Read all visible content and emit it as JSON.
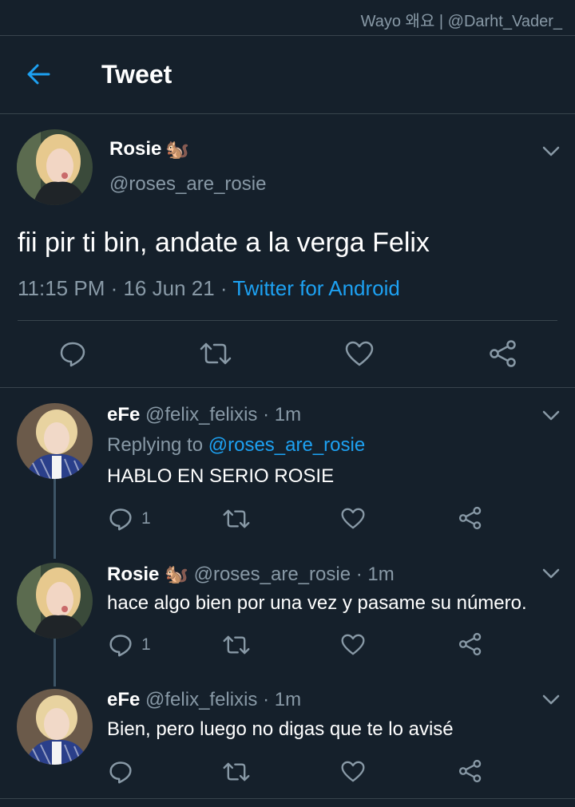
{
  "watermark": "Wayo 왜요 | @Darht_Vader_",
  "header": {
    "title": "Tweet",
    "back_icon": "arrow-left-icon"
  },
  "colors": {
    "background": "#15202b",
    "accent": "#1da1f2",
    "muted": "#8899a6",
    "divider": "#38444d"
  },
  "main_tweet": {
    "name": "Rosie",
    "emoji": "🐿️",
    "handle": "@roses_are_rosie",
    "text": "fii pir ti bin, andate a la verga Felix",
    "time": "11:15 PM · 16 Jun 21 · ",
    "source": "Twitter for Android",
    "actions": [
      "reply-icon",
      "retweet-icon",
      "like-icon",
      "share-icon"
    ]
  },
  "replies": [
    {
      "name": "eFe",
      "meta": " @felix_felixis · 1m",
      "replying_prefix": "Replying to ",
      "replying_to": "@roses_are_rosie",
      "text": "HABLO EN SERIO ROSIE",
      "reply_count": "1"
    },
    {
      "name": "Rosie",
      "emoji": "🐿️",
      "meta": " @roses_are_rosie · 1m",
      "text": "hace algo bien por una vez y pasame su número.",
      "reply_count": "1"
    },
    {
      "name": "eFe",
      "meta": " @felix_felixis · 1m",
      "text": "Bien, pero luego no digas que te lo avisé",
      "reply_count": ""
    }
  ]
}
